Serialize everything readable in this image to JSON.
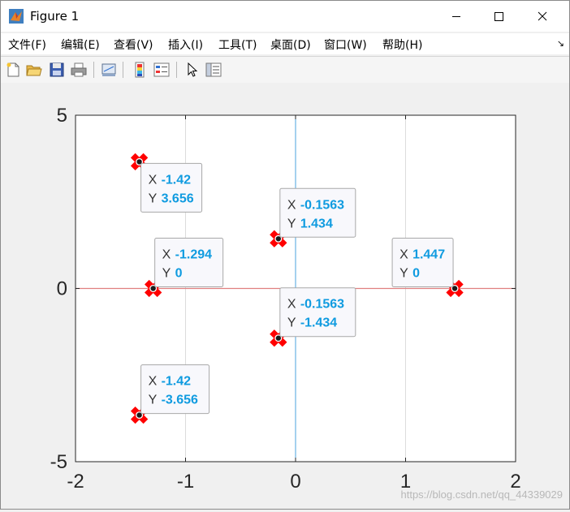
{
  "window": {
    "title": "Figure 1",
    "controls": {
      "minimize": "—",
      "maximize": "☐",
      "close": "✕"
    }
  },
  "menu": {
    "items": [
      "文件(F)",
      "编辑(E)",
      "查看(V)",
      "插入(I)",
      "工具(T)",
      "桌面(D)",
      "窗口(W)",
      "帮助(H)"
    ],
    "overflow_arrow": "↘"
  },
  "toolbar": {
    "buttons": [
      "new-figure-icon",
      "open-file-icon",
      "save-icon",
      "print-icon",
      "link-plot-icon",
      "colorbar-icon",
      "legend-icon",
      "pointer-icon",
      "property-inspector-icon"
    ]
  },
  "watermark": "https://blog.csdn.net/qq_44339029",
  "chart_data": {
    "type": "scatter",
    "xlim": [
      -2,
      2
    ],
    "ylim": [
      -5,
      5
    ],
    "xticks": [
      "-2",
      "-1",
      "0",
      "1",
      "2"
    ],
    "yticks": [
      "5",
      "0",
      "-5"
    ],
    "grid": "x-only",
    "points": [
      {
        "x": -1.42,
        "y": 3.656
      },
      {
        "x": -1.42,
        "y": -3.656
      },
      {
        "x": -1.294,
        "y": 0
      },
      {
        "x": -0.1563,
        "y": 1.434
      },
      {
        "x": -0.1563,
        "y": -1.434
      },
      {
        "x": 1.447,
        "y": 0
      }
    ],
    "datatips": [
      {
        "x_label": "X",
        "x_value": "-1.42",
        "y_label": "Y",
        "y_value": "3.656",
        "point": 0,
        "side": "below-right"
      },
      {
        "x_label": "X",
        "x_value": "-1.42",
        "y_label": "Y",
        "y_value": "-3.656",
        "point": 1,
        "side": "above-right"
      },
      {
        "x_label": "X",
        "x_value": "-1.294",
        "y_label": "Y",
        "y_value": "0",
        "point": 2,
        "side": "above-right"
      },
      {
        "x_label": "X",
        "x_value": "-0.1563",
        "y_label": "Y",
        "y_value": "1.434",
        "point": 3,
        "side": "above-right"
      },
      {
        "x_label": "X",
        "x_value": "-0.1563",
        "y_label": "Y",
        "y_value": "-1.434",
        "point": 4,
        "side": "above-right"
      },
      {
        "x_label": "X",
        "x_value": "1.447",
        "y_label": "Y",
        "y_value": "0",
        "point": 5,
        "side": "above-left"
      }
    ],
    "colors": {
      "marker": "#ff0000",
      "datatip_value": "#0f9be0",
      "zero_line_x": "#e08080",
      "zero_line_y": "#4aa3df",
      "grid": "#dcdcdc"
    }
  }
}
